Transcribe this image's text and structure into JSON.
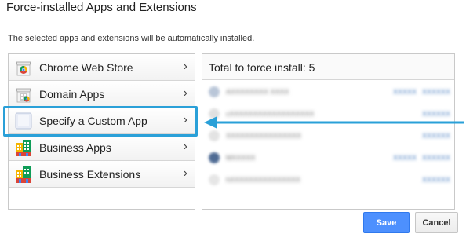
{
  "dialog": {
    "title": "Force-installed Apps and Extensions",
    "subtitle": "The selected apps and extensions will be automatically installed."
  },
  "menu": {
    "items": [
      {
        "label": "Chrome Web Store",
        "icon": "chrome-web-store-icon"
      },
      {
        "label": "Domain Apps",
        "icon": "domain-apps-icon"
      },
      {
        "label": "Specify a Custom App",
        "icon": "custom-app-icon",
        "selected": true
      },
      {
        "label": "Business Apps",
        "icon": "business-apps-icon"
      },
      {
        "label": "Business Extensions",
        "icon": "business-extensions-icon"
      }
    ],
    "chevron": "›"
  },
  "install_list": {
    "header": "Total to force install: 5",
    "apps": [
      {
        "name": "AXXXXXXXX XXXX",
        "actions": [
          "XXXXX",
          "XXXXXX"
        ]
      },
      {
        "name": "cXXXXXXXXXXXXXXXXXX",
        "actions": [
          "XXXXXX"
        ]
      },
      {
        "name": "XXXXXXXXXXXXXXXX",
        "actions": [
          "XXXXXX"
        ]
      },
      {
        "name": "MXXXXX",
        "actions": [
          "XXXXX",
          "XXXXXX"
        ]
      },
      {
        "name": "hXXXXXXXXXXXXXXX",
        "actions": [
          "XXXXXX"
        ]
      }
    ]
  },
  "footer": {
    "save_label": "Save",
    "cancel_label": "Cancel"
  },
  "colors": {
    "highlight": "#2aa0d8",
    "save_button": "#4d90fe"
  }
}
